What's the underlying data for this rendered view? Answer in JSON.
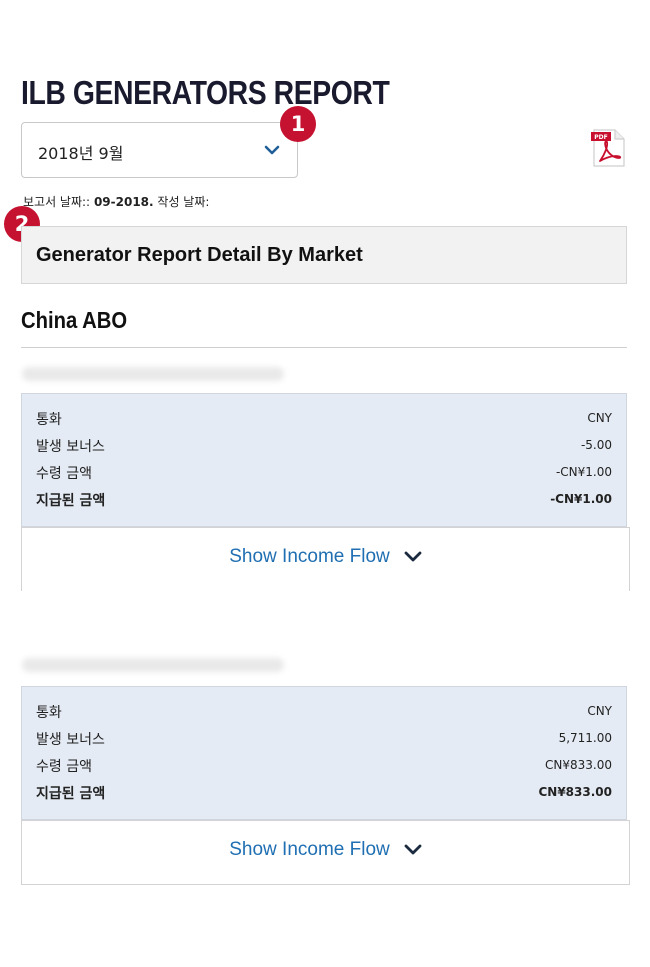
{
  "page": {
    "title": "ILB GENERATORS REPORT",
    "period_select": {
      "value": "2018년 9월",
      "icon": "chevron-down-icon"
    },
    "pdf_icon": "pdf-icon",
    "badges": [
      "1",
      "2"
    ],
    "report_date_label": "보고서 날짜::",
    "report_date_value": "09-2018.",
    "written_date_label": "작성 날짜:",
    "section_title": "Generator Report Detail By Market",
    "market_name": "China ABO"
  },
  "entries": [
    {
      "rows": [
        {
          "label": "통화",
          "value": "CNY"
        },
        {
          "label": "발생 보너스",
          "value": "-5.00"
        },
        {
          "label": "수령 금액",
          "value": "-CN¥1.00"
        },
        {
          "label": "지급된 금액",
          "value": "-CN¥1.00"
        }
      ],
      "show_flow_label": "Show Income Flow"
    },
    {
      "rows": [
        {
          "label": "통화",
          "value": "CNY"
        },
        {
          "label": "발생 보너스",
          "value": "5,711.00"
        },
        {
          "label": "수령 금액",
          "value": "CN¥833.00"
        },
        {
          "label": "지급된 금액",
          "value": "CN¥833.00"
        }
      ],
      "show_flow_label": "Show Income Flow"
    }
  ],
  "colors": {
    "accent_badge": "#c41230",
    "link_blue": "#1f6fb2",
    "card_bg": "#e4ebf4"
  }
}
